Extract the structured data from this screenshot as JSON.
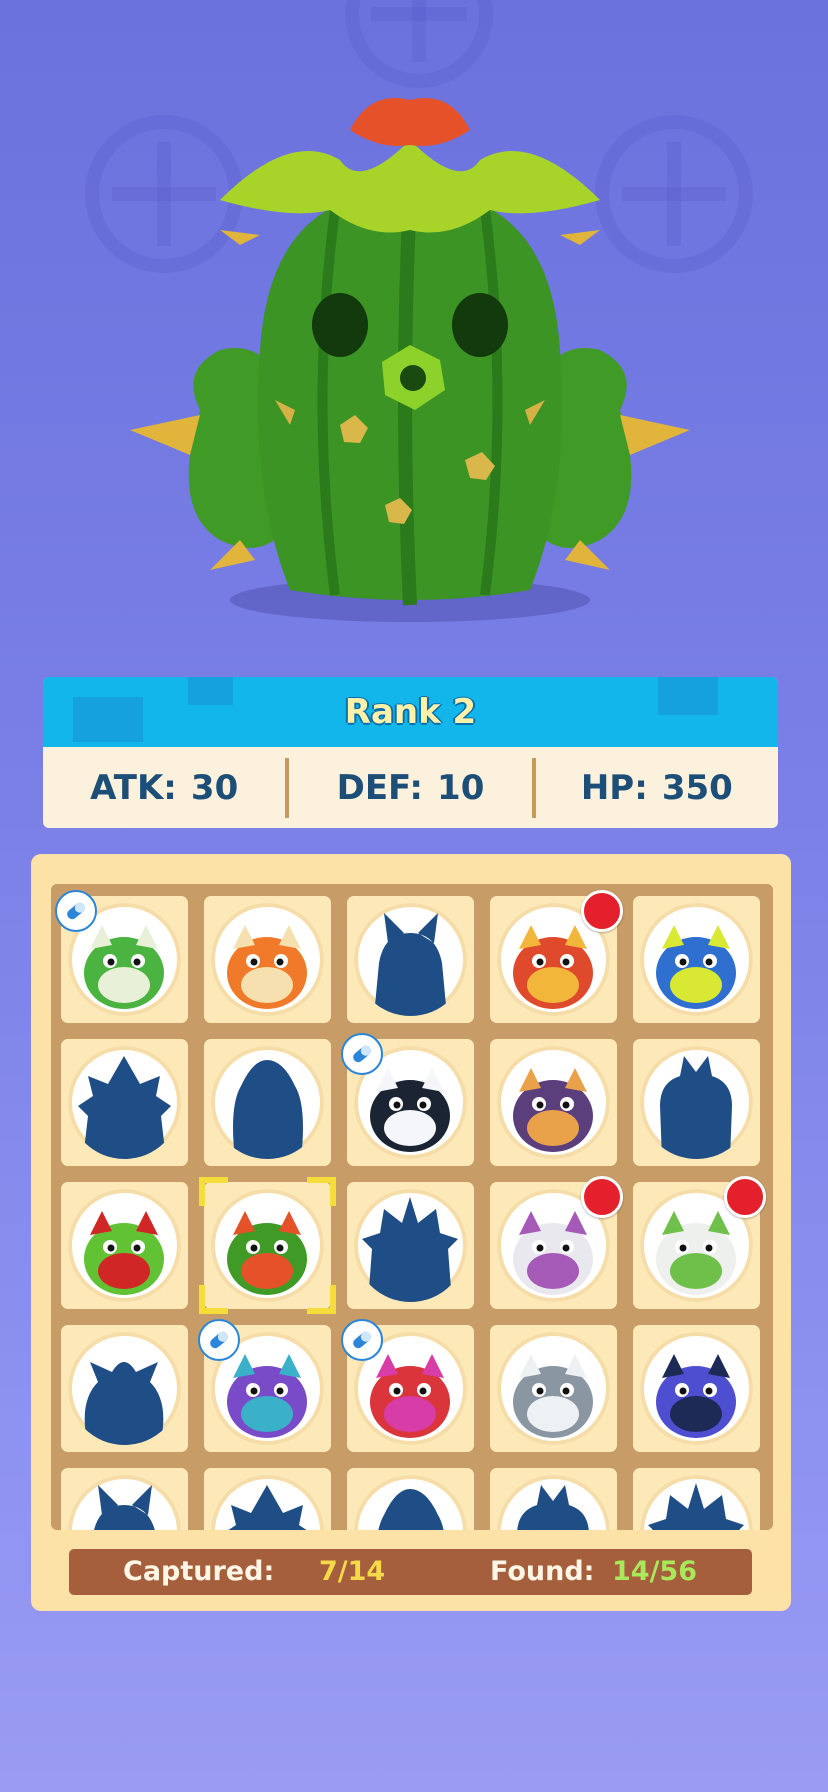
{
  "hero": {
    "name": "cactus-monster"
  },
  "stats": {
    "rank_label": "Rank 2",
    "atk_label": "ATK:",
    "atk_value": "30",
    "def_label": "DEF:",
    "def_value": "10",
    "hp_label": "HP:",
    "hp_value": "350"
  },
  "colors": {
    "rank_bar": "#12b6ea",
    "stat_text": "#1c4e78",
    "silhouette": "#1f4d85",
    "notification": "#e3202b",
    "captured_value": "#f5d94a",
    "found_value": "#a9e85a"
  },
  "collection": {
    "slots": [
      {
        "monster": "green-frog",
        "state": "captured",
        "badge": "capsule"
      },
      {
        "monster": "orange-frog",
        "state": "captured",
        "badge": ""
      },
      {
        "monster": "unknown",
        "state": "silhouette",
        "badge": ""
      },
      {
        "monster": "red-spiky-dragon",
        "state": "found",
        "badge": "notification"
      },
      {
        "monster": "blue-spiky-creature",
        "state": "found",
        "badge": ""
      },
      {
        "monster": "unknown",
        "state": "silhouette",
        "badge": ""
      },
      {
        "monster": "unknown",
        "state": "silhouette",
        "badge": ""
      },
      {
        "monster": "penguin",
        "state": "captured",
        "badge": "capsule"
      },
      {
        "monster": "emperor-penguin",
        "state": "found",
        "badge": ""
      },
      {
        "monster": "unknown",
        "state": "silhouette",
        "badge": ""
      },
      {
        "monster": "green-cyclops",
        "state": "found",
        "badge": ""
      },
      {
        "monster": "cactus-monster",
        "state": "selected",
        "badge": ""
      },
      {
        "monster": "unknown",
        "state": "silhouette",
        "badge": ""
      },
      {
        "monster": "white-yeti",
        "state": "found",
        "badge": "notification"
      },
      {
        "monster": "armored-yeti",
        "state": "found",
        "badge": "notification"
      },
      {
        "monster": "unknown",
        "state": "silhouette",
        "badge": ""
      },
      {
        "monster": "purple-horned-beast",
        "state": "captured",
        "badge": "capsule"
      },
      {
        "monster": "red-crystal-beast",
        "state": "captured",
        "badge": "capsule"
      },
      {
        "monster": "grey-shark",
        "state": "found",
        "badge": ""
      },
      {
        "monster": "pirate-shark",
        "state": "found",
        "badge": ""
      },
      {
        "monster": "unknown",
        "state": "silhouette",
        "badge": ""
      },
      {
        "monster": "unknown",
        "state": "silhouette",
        "badge": ""
      },
      {
        "monster": "unknown",
        "state": "silhouette",
        "badge": ""
      },
      {
        "monster": "unknown",
        "state": "silhouette",
        "badge": ""
      },
      {
        "monster": "unknown",
        "state": "silhouette",
        "badge": ""
      }
    ],
    "captured_label": "Captured:",
    "captured_value": "7/14",
    "found_label": "Found:",
    "found_value": "14/56"
  }
}
